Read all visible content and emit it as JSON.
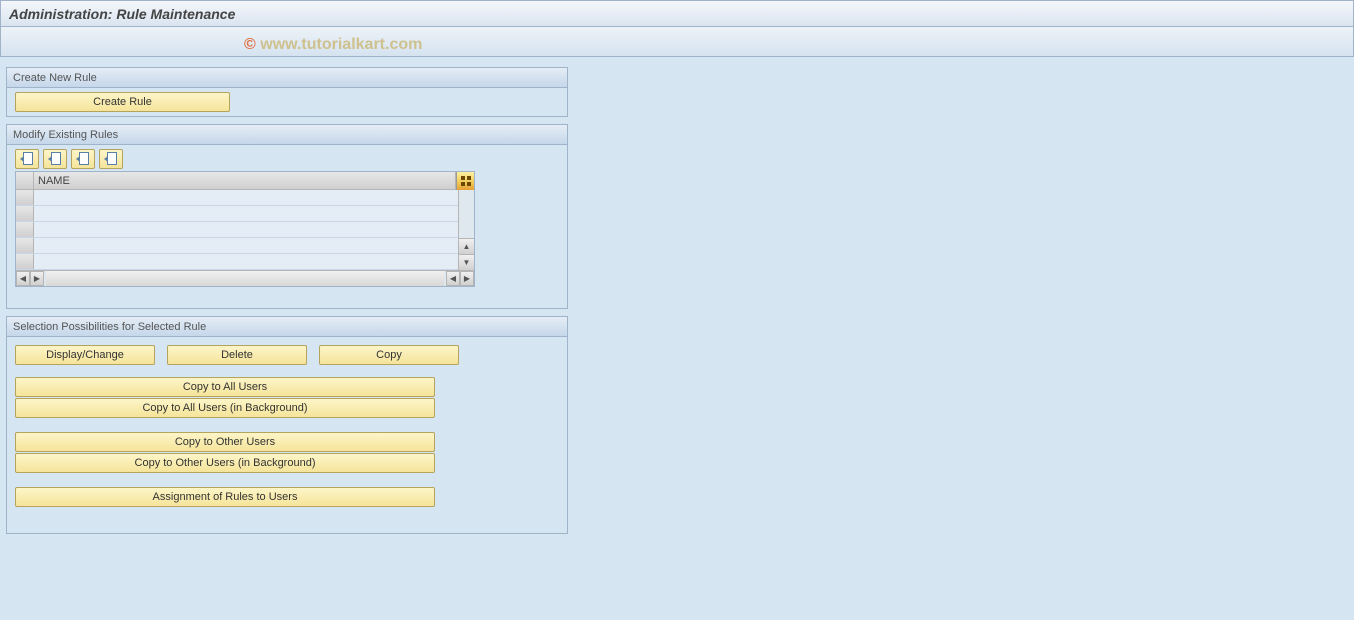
{
  "watermark": {
    "copyright": "©",
    "text": " www.tutorialkart.com"
  },
  "title": "Administration: Rule Maintenance",
  "panels": {
    "create": {
      "header": "Create New Rule",
      "button": "Create Rule"
    },
    "modify": {
      "header": "Modify Existing Rules",
      "column": "NAME"
    },
    "selection": {
      "header": "Selection Possibilities for Selected Rule",
      "display_change": "Display/Change",
      "delete": "Delete",
      "copy": "Copy",
      "copy_all": "Copy to All Users",
      "copy_all_bg": "Copy to All Users (in Background)",
      "copy_other": "Copy to Other Users",
      "copy_other_bg": "Copy to Other Users (in Background)",
      "assign": "Assignment of Rules to Users"
    }
  }
}
